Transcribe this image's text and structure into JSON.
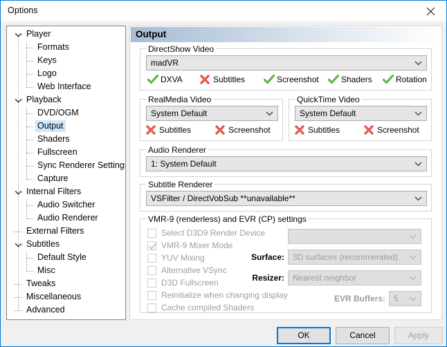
{
  "window": {
    "title": "Options",
    "close_icon": "close-icon"
  },
  "sidebar": {
    "items": [
      {
        "label": "Player",
        "level": 0,
        "twisty": "expanded",
        "selected": false
      },
      {
        "label": "Formats",
        "level": 1,
        "twisty": "none",
        "selected": false
      },
      {
        "label": "Keys",
        "level": 1,
        "twisty": "none",
        "selected": false
      },
      {
        "label": "Logo",
        "level": 1,
        "twisty": "none",
        "selected": false
      },
      {
        "label": "Web Interface",
        "level": 1,
        "twisty": "none",
        "selected": false
      },
      {
        "label": "Playback",
        "level": 0,
        "twisty": "expanded",
        "selected": false
      },
      {
        "label": "DVD/OGM",
        "level": 1,
        "twisty": "none",
        "selected": false
      },
      {
        "label": "Output",
        "level": 1,
        "twisty": "none",
        "selected": true
      },
      {
        "label": "Shaders",
        "level": 1,
        "twisty": "none",
        "selected": false
      },
      {
        "label": "Fullscreen",
        "level": 1,
        "twisty": "none",
        "selected": false
      },
      {
        "label": "Sync Renderer Settings",
        "level": 1,
        "twisty": "none",
        "selected": false
      },
      {
        "label": "Capture",
        "level": 1,
        "twisty": "none",
        "selected": false
      },
      {
        "label": "Internal Filters",
        "level": 0,
        "twisty": "expanded",
        "selected": false
      },
      {
        "label": "Audio Switcher",
        "level": 1,
        "twisty": "none",
        "selected": false
      },
      {
        "label": "Audio Renderer",
        "level": 1,
        "twisty": "none",
        "selected": false
      },
      {
        "label": "External Filters",
        "level": 0,
        "twisty": "none",
        "selected": false
      },
      {
        "label": "Subtitles",
        "level": 0,
        "twisty": "expanded",
        "selected": false
      },
      {
        "label": "Default Style",
        "level": 1,
        "twisty": "none",
        "selected": false
      },
      {
        "label": "Misc",
        "level": 1,
        "twisty": "none",
        "selected": false
      },
      {
        "label": "Tweaks",
        "level": 0,
        "twisty": "none",
        "selected": false
      },
      {
        "label": "Miscellaneous",
        "level": 0,
        "twisty": "none",
        "selected": false
      },
      {
        "label": "Advanced",
        "level": 0,
        "twisty": "none",
        "selected": false
      }
    ]
  },
  "page": {
    "title": "Output",
    "directshow": {
      "caption": "DirectShow Video",
      "value": "madVR",
      "caps": [
        {
          "label": "DXVA",
          "state": "yes"
        },
        {
          "label": "Subtitles",
          "state": "no"
        },
        {
          "label": "Screenshot",
          "state": "yes"
        },
        {
          "label": "Shaders",
          "state": "yes"
        },
        {
          "label": "Rotation",
          "state": "yes"
        }
      ]
    },
    "realmedia": {
      "caption": "RealMedia Video",
      "value": "System Default",
      "caps": [
        {
          "label": "Subtitles",
          "state": "no"
        },
        {
          "label": "Screenshot",
          "state": "no"
        }
      ]
    },
    "quicktime": {
      "caption": "QuickTime Video",
      "value": "System Default",
      "caps": [
        {
          "label": "Subtitles",
          "state": "no"
        },
        {
          "label": "Screenshot",
          "state": "no"
        }
      ]
    },
    "audio_renderer": {
      "caption": "Audio Renderer",
      "value": "1: System Default"
    },
    "subtitle_renderer": {
      "caption": "Subtitle Renderer",
      "value": "VSFilter / DirectVobSub **unavailable**"
    },
    "vmr9": {
      "caption": "VMR-9 (renderless) and EVR (CP) settings",
      "checkboxes": [
        {
          "label": "Select D3D9 Render Device",
          "checked": false,
          "enabled": false
        },
        {
          "label": "VMR-9 Mixer Mode",
          "checked": true,
          "enabled": false
        },
        {
          "label": "YUV Mixing",
          "checked": false,
          "enabled": false
        },
        {
          "label": "Alternative VSync",
          "checked": false,
          "enabled": false
        },
        {
          "label": "D3D Fullscreen",
          "checked": false,
          "enabled": false
        },
        {
          "label": "Reinitialize when changing display",
          "checked": false,
          "enabled": false
        },
        {
          "label": "Cache compiled Shaders",
          "checked": false,
          "enabled": false
        }
      ],
      "device_combo_value": "",
      "surface_label": "Surface:",
      "surface_value": "3D surfaces (recommended)",
      "resizer_label": "Resizer:",
      "resizer_value": "Nearest neighbor",
      "evr_buffers_label": "EVR Buffers:",
      "evr_buffers_value": "5"
    }
  },
  "footer": {
    "ok": "OK",
    "cancel": "Cancel",
    "apply": "Apply"
  },
  "colors": {
    "accent": "#0078d7",
    "selection": "#cce8ff",
    "check_green": "#4a9e2a",
    "cross_red": "#e03a30",
    "header_gradient_start": "#a7bcd3"
  }
}
